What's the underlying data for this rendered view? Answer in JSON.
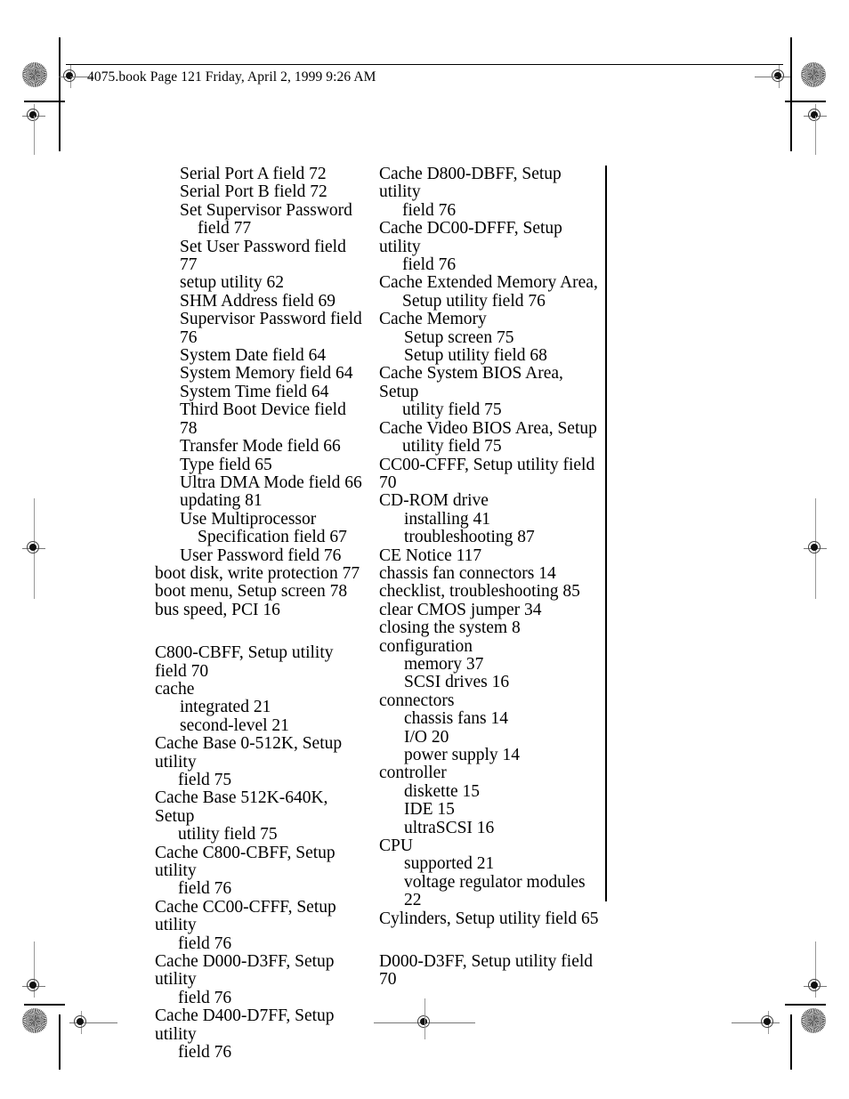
{
  "header": {
    "text": "4075.book  Page 121  Friday, April 2, 1999  9:26 AM"
  },
  "index": {
    "left_column": [
      {
        "level": 1,
        "lines": [
          "Serial Port A field 72"
        ]
      },
      {
        "level": 1,
        "lines": [
          "Serial Port B field 72"
        ]
      },
      {
        "level": 1,
        "lines": [
          "Set Supervisor Password",
          "field 77"
        ]
      },
      {
        "level": 1,
        "lines": [
          "Set User Password field 77"
        ]
      },
      {
        "level": 1,
        "lines": [
          "setup utility 62"
        ]
      },
      {
        "level": 1,
        "lines": [
          "SHM Address field 69"
        ]
      },
      {
        "level": 1,
        "lines": [
          "Supervisor Password field 76"
        ]
      },
      {
        "level": 1,
        "lines": [
          "System Date field 64"
        ]
      },
      {
        "level": 1,
        "lines": [
          "System Memory field 64"
        ]
      },
      {
        "level": 1,
        "lines": [
          "System Time field 64"
        ]
      },
      {
        "level": 1,
        "lines": [
          "Third Boot Device field 78"
        ]
      },
      {
        "level": 1,
        "lines": [
          "Transfer Mode field 66"
        ]
      },
      {
        "level": 1,
        "lines": [
          "Type field 65"
        ]
      },
      {
        "level": 1,
        "lines": [
          "Ultra DMA Mode field 66"
        ]
      },
      {
        "level": 1,
        "lines": [
          "updating 81"
        ]
      },
      {
        "level": 1,
        "lines": [
          "Use Multiprocessor",
          "Specification field 67"
        ]
      },
      {
        "level": 1,
        "lines": [
          "User Password field 76"
        ]
      },
      {
        "level": 0,
        "lines": [
          "boot disk, write protection 77"
        ]
      },
      {
        "level": 0,
        "lines": [
          "boot menu, Setup screen 78"
        ]
      },
      {
        "level": 0,
        "lines": [
          "bus speed, PCI 16"
        ]
      },
      {
        "level": -1,
        "lines": []
      },
      {
        "level": 0,
        "lines": [
          "C800-CBFF, Setup utility field 70"
        ]
      },
      {
        "level": 0,
        "lines": [
          "cache"
        ]
      },
      {
        "level": 1,
        "lines": [
          "integrated 21"
        ]
      },
      {
        "level": 1,
        "lines": [
          "second-level 21"
        ]
      },
      {
        "level": 0,
        "lines": [
          "Cache Base 0-512K, Setup utility",
          "field 75"
        ]
      },
      {
        "level": 0,
        "lines": [
          "Cache Base 512K-640K, Setup",
          "utility field 75"
        ]
      },
      {
        "level": 0,
        "lines": [
          "Cache C800-CBFF, Setup utility",
          "field 76"
        ]
      },
      {
        "level": 0,
        "lines": [
          "Cache CC00-CFFF, Setup utility",
          "field 76"
        ]
      },
      {
        "level": 0,
        "lines": [
          "Cache D000-D3FF, Setup utility",
          "field 76"
        ]
      },
      {
        "level": 0,
        "lines": [
          "Cache D400-D7FF, Setup utility",
          "field 76"
        ]
      }
    ],
    "right_column": [
      {
        "level": 0,
        "lines": [
          "Cache D800-DBFF, Setup utility",
          "field 76"
        ]
      },
      {
        "level": 0,
        "lines": [
          "Cache DC00-DFFF, Setup utility",
          "field 76"
        ]
      },
      {
        "level": 0,
        "lines": [
          "Cache Extended Memory Area,",
          "Setup utility field 76"
        ]
      },
      {
        "level": 0,
        "lines": [
          "Cache Memory"
        ]
      },
      {
        "level": 1,
        "lines": [
          "Setup screen 75"
        ]
      },
      {
        "level": 1,
        "lines": [
          "Setup utility field 68"
        ]
      },
      {
        "level": 0,
        "lines": [
          "Cache System BIOS Area, Setup",
          "utility field 75"
        ]
      },
      {
        "level": 0,
        "lines": [
          "Cache Video BIOS Area, Setup",
          "utility field 75"
        ]
      },
      {
        "level": 0,
        "lines": [
          "CC00-CFFF, Setup utility field 70"
        ]
      },
      {
        "level": 0,
        "lines": [
          "CD-ROM drive"
        ]
      },
      {
        "level": 1,
        "lines": [
          "installing 41"
        ]
      },
      {
        "level": 1,
        "lines": [
          "troubleshooting 87"
        ]
      },
      {
        "level": 0,
        "lines": [
          "CE Notice 117"
        ]
      },
      {
        "level": 0,
        "lines": [
          "chassis fan connectors 14"
        ]
      },
      {
        "level": 0,
        "lines": [
          "checklist, troubleshooting 85"
        ]
      },
      {
        "level": 0,
        "lines": [
          "clear CMOS jumper 34"
        ]
      },
      {
        "level": 0,
        "lines": [
          "closing the system 8"
        ]
      },
      {
        "level": 0,
        "lines": [
          "configuration"
        ]
      },
      {
        "level": 1,
        "lines": [
          "memory 37"
        ]
      },
      {
        "level": 1,
        "lines": [
          "SCSI drives 16"
        ]
      },
      {
        "level": 0,
        "lines": [
          "connectors"
        ]
      },
      {
        "level": 1,
        "lines": [
          "chassis fans 14"
        ]
      },
      {
        "level": 1,
        "lines": [
          "I/O 20"
        ]
      },
      {
        "level": 1,
        "lines": [
          "power supply 14"
        ]
      },
      {
        "level": 0,
        "lines": [
          "controller"
        ]
      },
      {
        "level": 1,
        "lines": [
          "diskette 15"
        ]
      },
      {
        "level": 1,
        "lines": [
          "IDE 15"
        ]
      },
      {
        "level": 1,
        "lines": [
          "ultraSCSI 16"
        ]
      },
      {
        "level": 0,
        "lines": [
          "CPU"
        ]
      },
      {
        "level": 1,
        "lines": [
          "supported 21"
        ]
      },
      {
        "level": 1,
        "lines": [
          "voltage regulator modules 22"
        ]
      },
      {
        "level": 0,
        "lines": [
          "Cylinders, Setup utility field 65"
        ]
      },
      {
        "level": -1,
        "lines": []
      },
      {
        "level": 0,
        "lines": [
          "D000-D3FF, Setup utility field 70"
        ]
      }
    ]
  },
  "marks": {
    "registration_label": "registration-target",
    "moire_label": "moire-density-patch",
    "ink_color": "#000000"
  }
}
